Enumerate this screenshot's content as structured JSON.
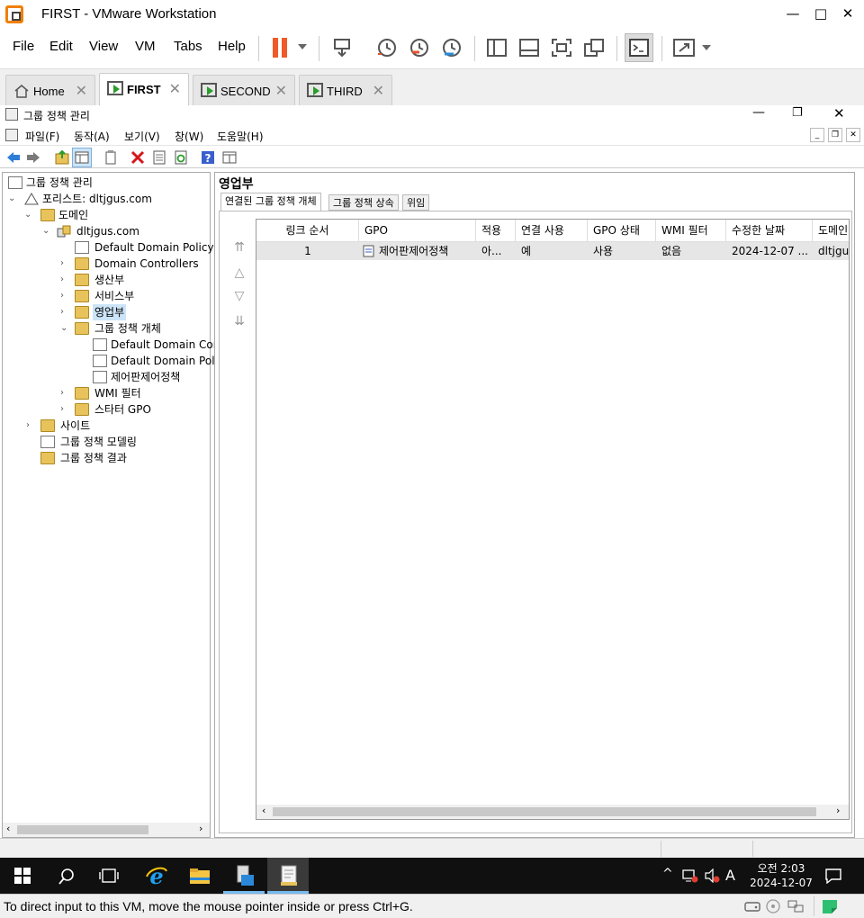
{
  "vm": {
    "window_title": "FIRST - VMware Workstation",
    "menu": [
      "File",
      "Edit",
      "View",
      "VM",
      "Tabs",
      "Help"
    ],
    "tabs": [
      {
        "label": "Home"
      },
      {
        "label": "FIRST"
      },
      {
        "label": "SECOND"
      },
      {
        "label": "THIRD"
      }
    ],
    "status_message": "To direct input to this VM, move the mouse pointer inside or press Ctrl+G."
  },
  "mmc": {
    "title": "그룹 정책 관리",
    "menu": [
      "파일(F)",
      "동작(A)",
      "보기(V)",
      "창(W)",
      "도움말(H)"
    ],
    "tree": {
      "root": "그룹 정책 관리",
      "forest": "포리스트: dltjgus.com",
      "domains": "도메인",
      "domain": "dltjgus.com",
      "default_policy": "Default Domain Policy",
      "domain_controllers": "Domain Controllers",
      "ou1": "생산부",
      "ou2": "서비스부",
      "ou3": "영업부",
      "gpo_container": "그룹 정책 개체",
      "gpo1": "Default Domain Cor",
      "gpo2": "Default Domain Poli",
      "gpo3": "제어판제어정책",
      "wmi": "WMI 필터",
      "starter": "스타터 GPO",
      "sites": "사이트",
      "modeling": "그룹 정책 모델링",
      "results": "그룹 정책 결과"
    },
    "right": {
      "header": "영업부",
      "tabs": [
        "연결된 그룹 정책 개체",
        "그룹 정책 상속",
        "위임"
      ],
      "columns": [
        "링크 순서",
        "GPO",
        "적용",
        "연결 사용",
        "GPO 상태",
        "WMI 필터",
        "수정한 날짜",
        "도메인"
      ],
      "rows": [
        [
          "1",
          "제어판제어정책",
          "아...",
          "예",
          "사용",
          "없음",
          "2024-12-07 ...",
          "dltjgus"
        ]
      ]
    }
  },
  "taskbar": {
    "time": "오전 2:03",
    "date": "2024-12-07",
    "ime": "A"
  },
  "colors": {
    "accent": "#76b9ed",
    "pause": "#f05a28"
  }
}
